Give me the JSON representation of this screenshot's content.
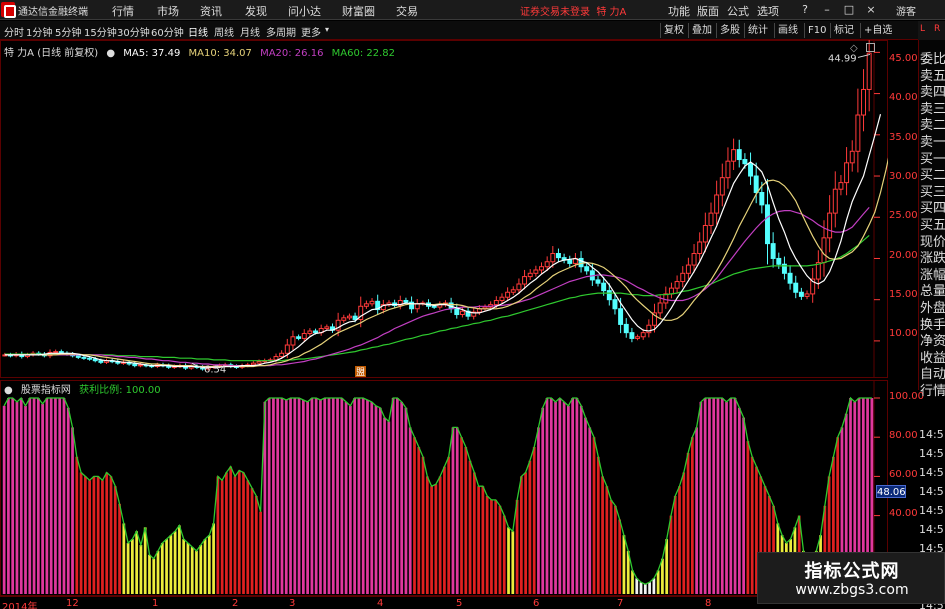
{
  "app": {
    "title": "通达信金融终端",
    "menus": [
      "行情",
      "市场",
      "资讯",
      "发现",
      "问小达",
      "财富圈",
      "交易"
    ],
    "login_status": "证券交易未登录",
    "stock_name": "特 力A",
    "right_menus": [
      "功能",
      "版面",
      "公式",
      "选项"
    ],
    "window_controls": [
      "?",
      "–",
      "□",
      "×"
    ],
    "guest": "游客"
  },
  "toolbar": {
    "periods": [
      "分时",
      "1分钟",
      "5分钟",
      "15分钟",
      "30分钟",
      "60分钟",
      "日线",
      "周线",
      "月线",
      "多周期",
      "更多"
    ],
    "active_period": "日线",
    "tools": [
      "复权",
      "叠加",
      "多股",
      "统计",
      "画线",
      "F10",
      "标记",
      "+自选"
    ],
    "side_top_left": "L",
    "side_top_right": "R"
  },
  "main_info": {
    "title": "特 力A (日线 前复权)",
    "ma5": "MA5: 37.49",
    "ma10": "MA10: 34.07",
    "ma20": "MA20: 26.16",
    "ma60": "MA60: 22.82"
  },
  "indicator_info": {
    "source": "股票指标网",
    "ratio_label": "获利比例: 100.00"
  },
  "colors": {
    "up": "#ff3a3a",
    "down": "#54ffff",
    "ma5": "#ffffff",
    "ma10": "#e6d27a",
    "ma20": "#c23fc2",
    "ma60": "#2fc92f",
    "bar_pink": "#e0379d",
    "bar_red": "#e02020",
    "bar_yellow": "#ecec3c",
    "bar_white": "#f2f2f2"
  },
  "chart_data": [
    {
      "type": "candlestick",
      "title": "特 力A (日线 前复权)",
      "y_ticks": [
        "45.00",
        "40.00",
        "35.00",
        "30.00",
        "25.00",
        "20.00",
        "15.00",
        "10.00"
      ],
      "ylim": [
        5.5,
        46.5
      ],
      "annotations": [
        {
          "text": "44.99",
          "value": 44.99
        },
        {
          "text": "6.54",
          "value": 6.54
        }
      ],
      "close": [
        8.3,
        8.2,
        8.4,
        8.1,
        8.3,
        8.5,
        8.4,
        8.2,
        8.6,
        8.7,
        8.5,
        8.4,
        8.2,
        8.0,
        7.9,
        7.8,
        7.6,
        7.4,
        7.6,
        7.5,
        7.3,
        7.4,
        7.2,
        7.0,
        7.1,
        7.0,
        6.9,
        7.1,
        7.0,
        6.8,
        6.9,
        7.0,
        6.7,
        6.9,
        6.8,
        6.6,
        6.8,
        6.9,
        7.0,
        7.1,
        6.9,
        6.8,
        7.0,
        7.1,
        7.3,
        7.5,
        7.6,
        7.7,
        8.1,
        8.5,
        9.5,
        10.5,
        10.3,
        10.9,
        11.2,
        11.0,
        11.5,
        11.7,
        11.3,
        12.5,
        12.8,
        13.0,
        12.6,
        14.2,
        14.5,
        14.8,
        13.8,
        14.4,
        14.6,
        14.3,
        14.9,
        14.7,
        13.9,
        14.5,
        14.6,
        14.2,
        14.1,
        14.4,
        14.6,
        13.9,
        13.2,
        13.6,
        13.0,
        13.5,
        13.9,
        14.1,
        14.4,
        14.9,
        15.3,
        15.9,
        16.2,
        16.9,
        17.8,
        18.2,
        18.6,
        19.0,
        19.6,
        20.6,
        20.1,
        19.8,
        19.4,
        20.0,
        19.0,
        18.5,
        17.4,
        17.0,
        16.1,
        15.0,
        13.9,
        12.0,
        11.0,
        10.3,
        10.5,
        11.0,
        11.9,
        13.4,
        14.6,
        15.7,
        16.4,
        17.2,
        18.2,
        19.2,
        20.6,
        22.0,
        24.0,
        25.5,
        27.7,
        29.8,
        31.8,
        33.2,
        32.0,
        31.5,
        30.0,
        28.0,
        26.5,
        21.8,
        20.0,
        19.3,
        18.2,
        17.0,
        15.9,
        15.4,
        15.7,
        17.5,
        19.5,
        22.5,
        25.5,
        28.4,
        29.2,
        31.6,
        33.0,
        37.4,
        40.5,
        44.9
      ],
      "ma5": [
        8.3,
        8.3,
        8.3,
        8.3,
        8.3,
        8.3,
        8.3,
        8.4,
        8.5,
        8.5,
        8.5,
        8.5,
        8.5,
        8.4,
        8.2,
        8.1,
        7.9,
        7.7,
        7.6,
        7.6,
        7.5,
        7.4,
        7.4,
        7.3,
        7.2,
        7.1,
        7.0,
        7.0,
        7.0,
        7.0,
        6.9,
        6.9,
        6.9,
        6.9,
        6.9,
        6.8,
        6.8,
        6.8,
        6.8,
        6.9,
        6.9,
        6.9,
        7.0,
        7.0,
        7.0,
        7.1,
        7.3,
        7.4,
        7.6,
        7.9,
        8.3,
        8.8,
        9.3,
        9.9,
        10.5,
        10.9,
        11.0,
        11.3,
        11.3,
        11.6,
        12.0,
        12.3,
        12.4,
        13.0,
        13.4,
        13.8,
        13.9,
        14.3,
        14.4,
        14.4,
        14.4,
        14.6,
        14.5,
        14.5,
        14.5,
        14.4,
        14.3,
        14.4,
        14.4,
        14.2,
        14.0,
        13.8,
        13.5,
        13.4,
        13.4,
        13.6,
        13.8,
        14.2,
        14.5,
        14.9,
        15.3,
        15.8,
        16.4,
        17.0,
        17.5,
        18.1,
        18.6,
        19.2,
        19.6,
        19.8,
        19.9,
        20.0,
        19.7,
        19.5,
        18.9,
        18.4,
        17.6,
        16.8,
        15.7,
        14.6,
        13.6,
        12.6,
        11.8,
        11.3,
        11.2,
        11.4,
        12.1,
        13.0,
        14.0,
        15.2,
        16.2,
        17.3,
        18.4,
        19.6,
        21.0,
        22.5,
        23.9,
        25.7,
        27.4,
        29.1,
        30.2,
        31.2,
        31.7,
        31.2,
        30.5,
        28.9,
        26.8,
        24.8,
        23.2,
        21.3,
        20.0,
        18.9,
        17.9,
        17.2,
        16.9,
        17.3,
        18.4,
        20.1,
        22.1,
        24.7,
        26.9,
        28.5,
        30.0,
        32.5,
        34.9,
        37.5
      ],
      "ma10": [
        8.3,
        8.3,
        8.3,
        8.3,
        8.3,
        8.3,
        8.3,
        8.3,
        8.3,
        8.3,
        8.4,
        8.4,
        8.4,
        8.4,
        8.3,
        8.3,
        8.2,
        8.1,
        8.0,
        7.9,
        7.8,
        7.7,
        7.6,
        7.5,
        7.4,
        7.3,
        7.2,
        7.2,
        7.1,
        7.1,
        7.0,
        7.0,
        7.0,
        7.0,
        6.9,
        6.9,
        6.9,
        6.9,
        6.9,
        6.9,
        6.9,
        6.9,
        6.9,
        6.9,
        6.9,
        7.0,
        7.0,
        7.1,
        7.3,
        7.4,
        7.6,
        7.9,
        8.1,
        8.5,
        8.8,
        9.2,
        9.6,
        10.1,
        10.6,
        11.0,
        11.3,
        11.6,
        11.9,
        12.2,
        12.6,
        12.9,
        13.2,
        13.5,
        13.8,
        14.0,
        14.2,
        14.4,
        14.5,
        14.5,
        14.5,
        14.4,
        14.4,
        14.5,
        14.5,
        14.4,
        14.4,
        14.3,
        14.1,
        14.0,
        13.9,
        13.9,
        13.9,
        13.9,
        14.0,
        14.2,
        14.5,
        14.8,
        15.3,
        15.7,
        16.3,
        16.8,
        17.3,
        17.9,
        18.3,
        18.6,
        18.9,
        19.2,
        19.4,
        19.5,
        19.4,
        19.2,
        18.9,
        18.4,
        17.8,
        17.2,
        16.5,
        15.6,
        14.9,
        14.3,
        13.7,
        13.1,
        12.7,
        12.5,
        12.5,
        12.7,
        13.2,
        14.0,
        14.9,
        15.7,
        16.5,
        17.4,
        18.5,
        19.7,
        21.0,
        22.4,
        23.9,
        25.2,
        26.5,
        27.8,
        28.8,
        29.4,
        29.5,
        29.3,
        28.8,
        28.0,
        27.0,
        25.5,
        24.1,
        22.7,
        21.5,
        20.5,
        20.0,
        19.9,
        20.0,
        20.4,
        20.8,
        21.5,
        22.7,
        24.1,
        25.6,
        28.0,
        30.8,
        34.1
      ],
      "ma20": [
        8.3,
        8.3,
        8.3,
        8.3,
        8.3,
        8.3,
        8.3,
        8.3,
        8.3,
        8.3,
        8.3,
        8.3,
        8.3,
        8.3,
        8.3,
        8.3,
        8.3,
        8.3,
        8.2,
        8.2,
        8.1,
        8.1,
        8.0,
        8.0,
        7.9,
        7.8,
        7.8,
        7.7,
        7.6,
        7.6,
        7.5,
        7.4,
        7.4,
        7.3,
        7.3,
        7.2,
        7.2,
        7.1,
        7.1,
        7.1,
        7.0,
        7.0,
        7.0,
        7.0,
        7.0,
        7.0,
        7.0,
        7.0,
        7.1,
        7.1,
        7.2,
        7.3,
        7.4,
        7.5,
        7.7,
        7.8,
        8.0,
        8.2,
        8.4,
        8.6,
        8.8,
        9.0,
        9.3,
        9.5,
        9.8,
        10.1,
        10.4,
        10.8,
        11.1,
        11.5,
        11.8,
        12.1,
        12.4,
        12.7,
        13.0,
        13.2,
        13.4,
        13.6,
        13.8,
        13.9,
        14.0,
        14.1,
        14.1,
        14.1,
        14.2,
        14.2,
        14.2,
        14.3,
        14.3,
        14.4,
        14.5,
        14.7,
        14.9,
        15.1,
        15.4,
        15.7,
        16.0,
        16.3,
        16.6,
        16.9,
        17.2,
        17.4,
        17.6,
        17.8,
        17.9,
        18.0,
        18.0,
        17.9,
        17.8,
        17.6,
        17.3,
        16.9,
        16.5,
        16.2,
        15.8,
        15.5,
        15.2,
        15.0,
        14.9,
        14.9,
        14.9,
        15.1,
        15.4,
        15.8,
        16.3,
        16.9,
        17.6,
        18.5,
        19.4,
        20.3,
        21.2,
        22.1,
        22.9,
        23.7,
        24.4,
        25.0,
        25.4,
        25.7,
        25.8,
        25.8,
        25.6,
        25.4,
        25.0,
        24.6,
        24.1,
        23.7,
        23.4,
        23.2,
        23.2,
        23.4,
        23.8,
        24.6,
        25.4,
        26.2
      ],
      "ma60": [
        8.4,
        8.4,
        8.4,
        8.4,
        8.4,
        8.4,
        8.4,
        8.4,
        8.4,
        8.4,
        8.4,
        8.4,
        8.3,
        8.3,
        8.3,
        8.3,
        8.3,
        8.3,
        8.3,
        8.3,
        8.2,
        8.2,
        8.2,
        8.2,
        8.1,
        8.1,
        8.1,
        8.1,
        8.0,
        8.0,
        8.0,
        7.9,
        7.9,
        7.9,
        7.8,
        7.8,
        7.8,
        7.7,
        7.7,
        7.7,
        7.6,
        7.6,
        7.6,
        7.6,
        7.6,
        7.6,
        7.6,
        7.6,
        7.6,
        7.6,
        7.7,
        7.7,
        7.8,
        7.8,
        7.9,
        8.0,
        8.1,
        8.2,
        8.3,
        8.4,
        8.5,
        8.6,
        8.7,
        8.9,
        9.0,
        9.2,
        9.3,
        9.5,
        9.6,
        9.8,
        10.0,
        10.2,
        10.3,
        10.5,
        10.7,
        10.8,
        11.0,
        11.2,
        11.3,
        11.5,
        11.6,
        11.8,
        11.9,
        12.1,
        12.2,
        12.4,
        12.5,
        12.7,
        12.9,
        13.0,
        13.2,
        13.4,
        13.6,
        13.8,
        14.0,
        14.2,
        14.4,
        14.6,
        14.8,
        15.0,
        15.2,
        15.3,
        15.5,
        15.6,
        15.7,
        15.8,
        15.8,
        15.8,
        15.8,
        15.8,
        15.7,
        15.6,
        15.6,
        15.5,
        15.5,
        15.5,
        15.6,
        15.6,
        15.7,
        15.8,
        16.0,
        16.1,
        16.3,
        16.5,
        16.7,
        16.9,
        17.2,
        17.5,
        17.8,
        18.1,
        18.3,
        18.5,
        18.7,
        18.8,
        18.9,
        19.0,
        19.1,
        19.1,
        19.1,
        19.1,
        19.1,
        19.1,
        19.1,
        19.2,
        19.3,
        19.5,
        19.7,
        19.9,
        20.2,
        20.6,
        21.1,
        21.6,
        22.2,
        22.8
      ]
    },
    {
      "type": "bar",
      "title": "获利比例",
      "y_ticks": [
        "100.00",
        "80.00",
        "60.00",
        "40.00"
      ],
      "ylim": [
        0,
        100
      ],
      "current": "48.06",
      "values": [
        96,
        100,
        100,
        98,
        100,
        96,
        100,
        100,
        100,
        97,
        100,
        100,
        100,
        100,
        100,
        95,
        85,
        70,
        62,
        60,
        58,
        60,
        60,
        58,
        62,
        60,
        55,
        46,
        36,
        26,
        28,
        32,
        25,
        34,
        20,
        18,
        22,
        26,
        28,
        30,
        32,
        35,
        28,
        26,
        24,
        22,
        25,
        28,
        30,
        36,
        60,
        58,
        62,
        65,
        60,
        63,
        62,
        58,
        54,
        50,
        42,
        98,
        100,
        100,
        100,
        100,
        99,
        100,
        100,
        100,
        99,
        98,
        100,
        100,
        99,
        100,
        100,
        100,
        100,
        100,
        98,
        96,
        100,
        100,
        100,
        99,
        98,
        96,
        95,
        90,
        88,
        100,
        100,
        98,
        95,
        85,
        80,
        75,
        70,
        60,
        55,
        56,
        60,
        65,
        70,
        85,
        85,
        80,
        75,
        68,
        62,
        55,
        55,
        50,
        48,
        48,
        45,
        40,
        34,
        32,
        48,
        60,
        62,
        68,
        75,
        85,
        95,
        100,
        100,
        98,
        100,
        98,
        96,
        100,
        100,
        96,
        90,
        85,
        80,
        70,
        60,
        55,
        48,
        45,
        38,
        30,
        22,
        12,
        8,
        6,
        5,
        6,
        8,
        12,
        18,
        28,
        40,
        50,
        55,
        62,
        72,
        80,
        85,
        98,
        100,
        100,
        100,
        100,
        100,
        98,
        100,
        100,
        95,
        90,
        78,
        70,
        65,
        60,
        55,
        50,
        45,
        36,
        30,
        26,
        28,
        34,
        40,
        22,
        16,
        15,
        22,
        30,
        45,
        60,
        70,
        80,
        85,
        92,
        100,
        98,
        100,
        100,
        100,
        100
      ]
    }
  ],
  "y_axis": {
    "main": [
      "45.00",
      "40.00",
      "35.00",
      "30.00",
      "25.00",
      "20.00",
      "15.00",
      "10.00"
    ],
    "indicator": [
      "100.00",
      "80.00",
      "60.00",
      "40.00"
    ],
    "indicator_current": "48.06"
  },
  "side_panel": {
    "items": [
      "委比",
      "卖五",
      "卖四",
      "卖三",
      "卖二",
      "卖一",
      "买一",
      "买二",
      "买三",
      "买四",
      "买五",
      "现价",
      "涨跌",
      "涨幅",
      "总量",
      "外盘",
      "换手",
      "净资",
      "收益",
      "自动",
      "行情"
    ],
    "times": [
      "14:5",
      "14:5",
      "14:5",
      "14:5",
      "14:5",
      "14:5",
      "14:5",
      "14:5",
      "14:5",
      "14:5"
    ]
  },
  "x_axis": {
    "labels": [
      "2014年",
      "12",
      "1",
      "2",
      "3",
      "4",
      "5",
      "6",
      "7",
      "8"
    ]
  },
  "markers": {
    "event_marker": "盟"
  },
  "watermark": {
    "title": "指标公式网",
    "url": "www.zbgs3.com"
  }
}
